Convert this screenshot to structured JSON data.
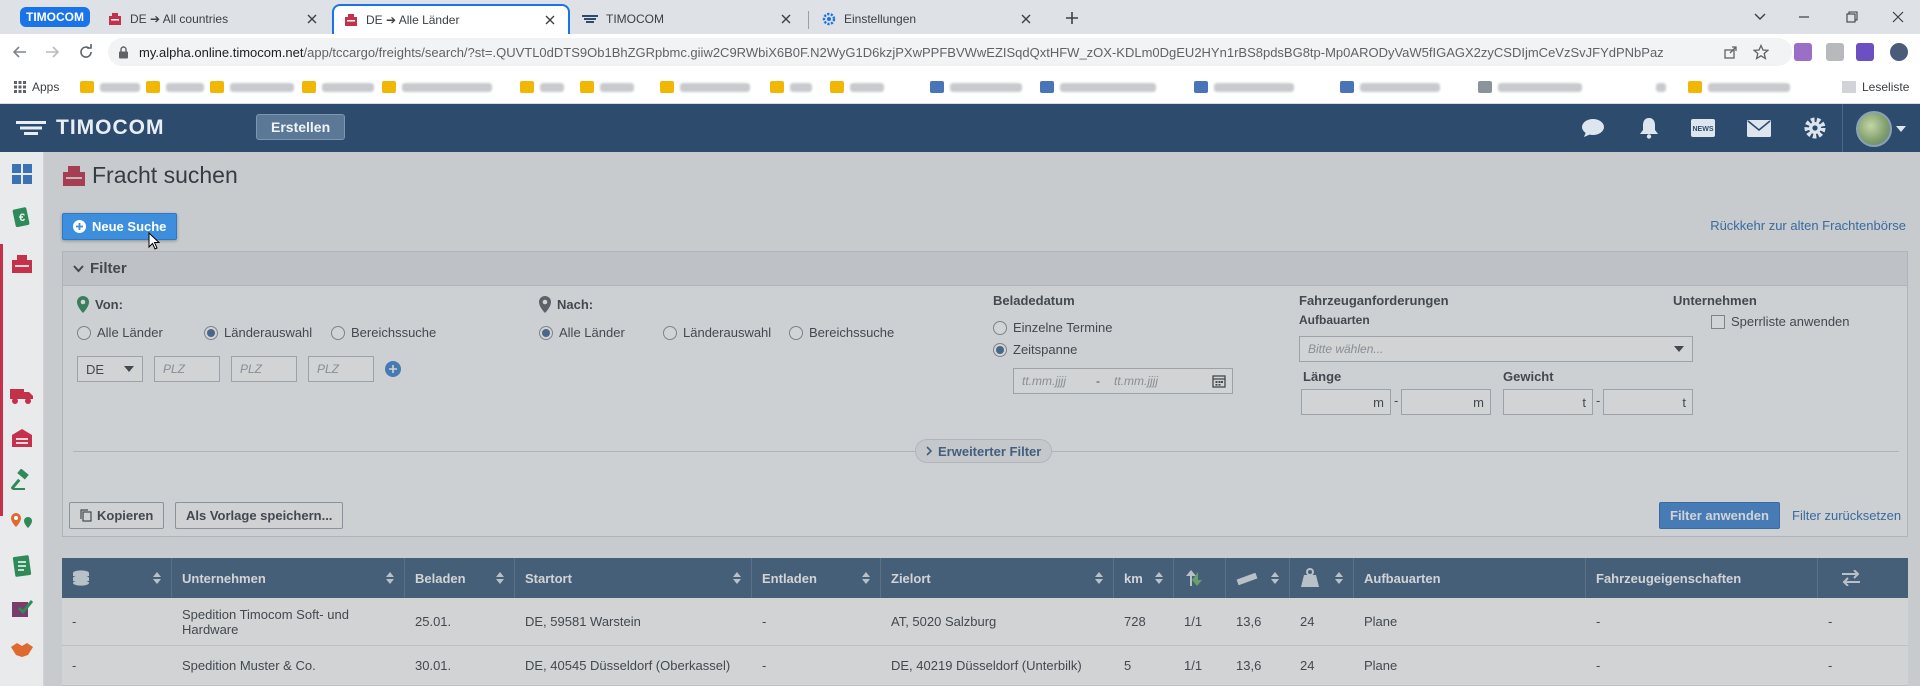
{
  "browser": {
    "group_label": "TIMOCOM",
    "tabs": [
      {
        "title": "DE ➔ All countries"
      },
      {
        "title": "DE ➔ Alle Länder"
      },
      {
        "title": "TIMOCOM"
      },
      {
        "title": "Einstellungen"
      }
    ],
    "url_host": "my.alpha.online.timocom.net",
    "url_path": "/app/tccargo/freights/search/?st=.QUVTL0dDTS9Ob1BhZGRpbmc.giiw2C9RWbiX6B0F.N2WyG1D6kzjPXwPPFBVWwEZISqdQxtHFW_zOX-KDLm0DgEU2HYn1rBS8pdsBG8tp-Mp0ARODyVaW5fIGAGX2zyCSDIjmCeVzSvJFYdPNbPaz",
    "bookmarks": {
      "apps_label": "Apps",
      "last_label": "Leseliste"
    }
  },
  "app": {
    "logo_text": "TIMOCOM",
    "create_label": "Erstellen",
    "header_icons": [
      "chat-icon",
      "bell-icon",
      "news-icon",
      "mail-icon",
      "gear-icon"
    ],
    "news_badge": "NEWS"
  },
  "page": {
    "title": "Fracht suchen",
    "new_search_label": "Neue Suche",
    "return_link": "Rückkehr zur alten Frachtenbörse"
  },
  "filter": {
    "header": "Filter",
    "from": {
      "label": "Von:",
      "options": [
        "Alle Länder",
        "Länderauswahl",
        "Bereichssuche"
      ],
      "selected": 1,
      "country": "DE",
      "zip_placeholder": "PLZ"
    },
    "to": {
      "label": "Nach:",
      "options": [
        "Alle Länder",
        "Länderauswahl",
        "Bereichssuche"
      ],
      "selected": 0
    },
    "loading_date": {
      "label": "Beladedatum",
      "options": [
        "Einzelne Termine",
        "Zeitspanne"
      ],
      "selected": 1,
      "date_placeholder": "tt.mm.jjjj"
    },
    "vehicle": {
      "label": "Fahrzeuganforderungen",
      "body_label": "Aufbauarten",
      "body_placeholder": "Bitte wählen...",
      "length_label": "Länge",
      "length_unit": "m",
      "weight_label": "Gewicht",
      "weight_unit": "t"
    },
    "company": {
      "label": "Unternehmen",
      "blocklist_label": "Sperrliste anwenden"
    },
    "extended_label": "Erweiterter Filter",
    "copy_label": "Kopieren",
    "save_template_label": "Als Vorlage speichern...",
    "apply_label": "Filter anwenden",
    "reset_label": "Filter zurücksetzen"
  },
  "table": {
    "columns": [
      "",
      "Unternehmen",
      "Beladen",
      "Startort",
      "Entladen",
      "Zielort",
      "km",
      "",
      "",
      "",
      "Aufbauarten",
      "Fahrzeugeigenschaften",
      ""
    ],
    "rows": [
      [
        "-",
        "Spedition Timocom Soft- und Hardware",
        "25.01.",
        "DE, 59581 Warstein",
        "-",
        "AT, 5020 Salzburg",
        "728",
        "1/1",
        "13,6",
        "24",
        "Plane",
        "-",
        "-"
      ],
      [
        "-",
        "Spedition Muster & Co.",
        "30.01.",
        "DE, 40545 Düsseldorf (Oberkassel)",
        "-",
        "DE, 40219 Düsseldorf (Unterbilk)",
        "5",
        "1/1",
        "13,6",
        "24",
        "Plane",
        "-",
        "-"
      ]
    ]
  },
  "colors": {
    "header_bg": "#2d4b6d",
    "table_head_bg": "#3f5f80",
    "primary": "#3d8fde",
    "brand_red": "#c4314b"
  }
}
